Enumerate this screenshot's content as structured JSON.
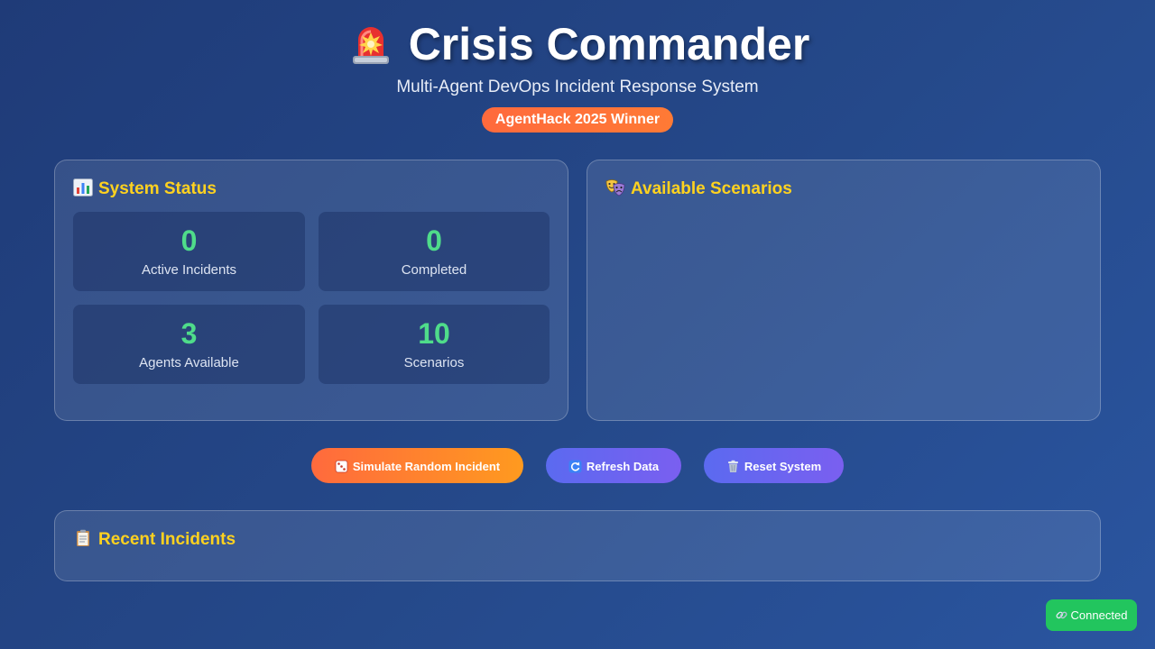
{
  "header": {
    "title": "Crisis Commander",
    "title_icon": "siren-icon",
    "subtitle": "Multi-Agent DevOps Incident Response System",
    "badge": "AgentHack 2025 Winner"
  },
  "system_status": {
    "title": "System Status",
    "icon": "bar-chart-icon",
    "stats": [
      {
        "value": "0",
        "label": "Active Incidents"
      },
      {
        "value": "0",
        "label": "Completed"
      },
      {
        "value": "3",
        "label": "Agents Available"
      },
      {
        "value": "10",
        "label": "Scenarios"
      }
    ]
  },
  "scenarios": {
    "title": "Available Scenarios",
    "icon": "theater-masks-icon"
  },
  "actions": {
    "simulate_label": "Simulate Random Incident",
    "simulate_icon": "dice-icon",
    "refresh_label": "Refresh Data",
    "refresh_icon": "refresh-icon",
    "reset_label": "Reset System",
    "reset_icon": "trash-icon"
  },
  "recent": {
    "title": "Recent Incidents",
    "icon": "clipboard-icon"
  },
  "connection": {
    "label": "Connected",
    "icon": "link-icon"
  },
  "colors": {
    "accent_yellow": "#ffd21f",
    "stat_green": "#4fdc8a",
    "orange": "#ff6a3d",
    "purple": "#6a64f0",
    "connected_green": "#22c55e"
  }
}
